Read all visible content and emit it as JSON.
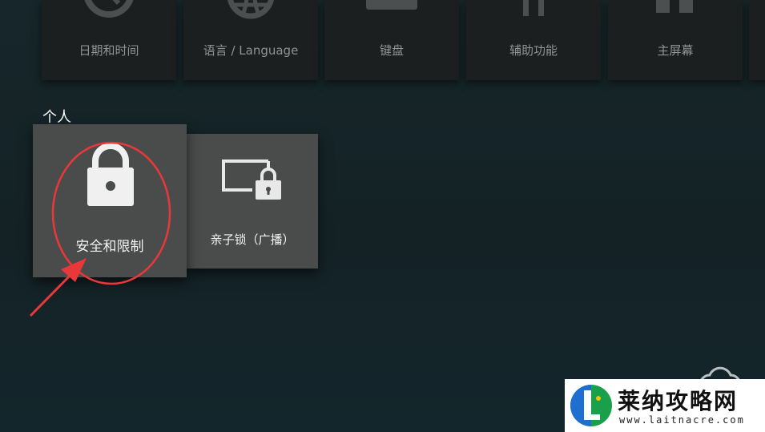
{
  "top_row": {
    "tiles": [
      {
        "label": "日期和时间",
        "icon": "clock-icon"
      },
      {
        "label": "语言 / Language",
        "icon": "globe-icon"
      },
      {
        "label": "键盘",
        "icon": "keyboard-icon"
      },
      {
        "label": "辅助功能",
        "icon": "accessibility-icon"
      },
      {
        "label": "主屏幕",
        "icon": "home-screen-icon"
      }
    ]
  },
  "personal": {
    "title": "个人",
    "cards": [
      {
        "label": "安全和限制",
        "icon": "lock-icon",
        "state": "focused"
      },
      {
        "label": "亲子锁（广播）",
        "icon": "screen-lock-icon"
      }
    ]
  },
  "watermark": {
    "title": "莱纳攻略网",
    "url": "www.laitnacre.com"
  },
  "colors": {
    "background": "#142226",
    "tile": "#1c1f20",
    "card": "#4a4c4c",
    "annotation": "#e8383a"
  }
}
